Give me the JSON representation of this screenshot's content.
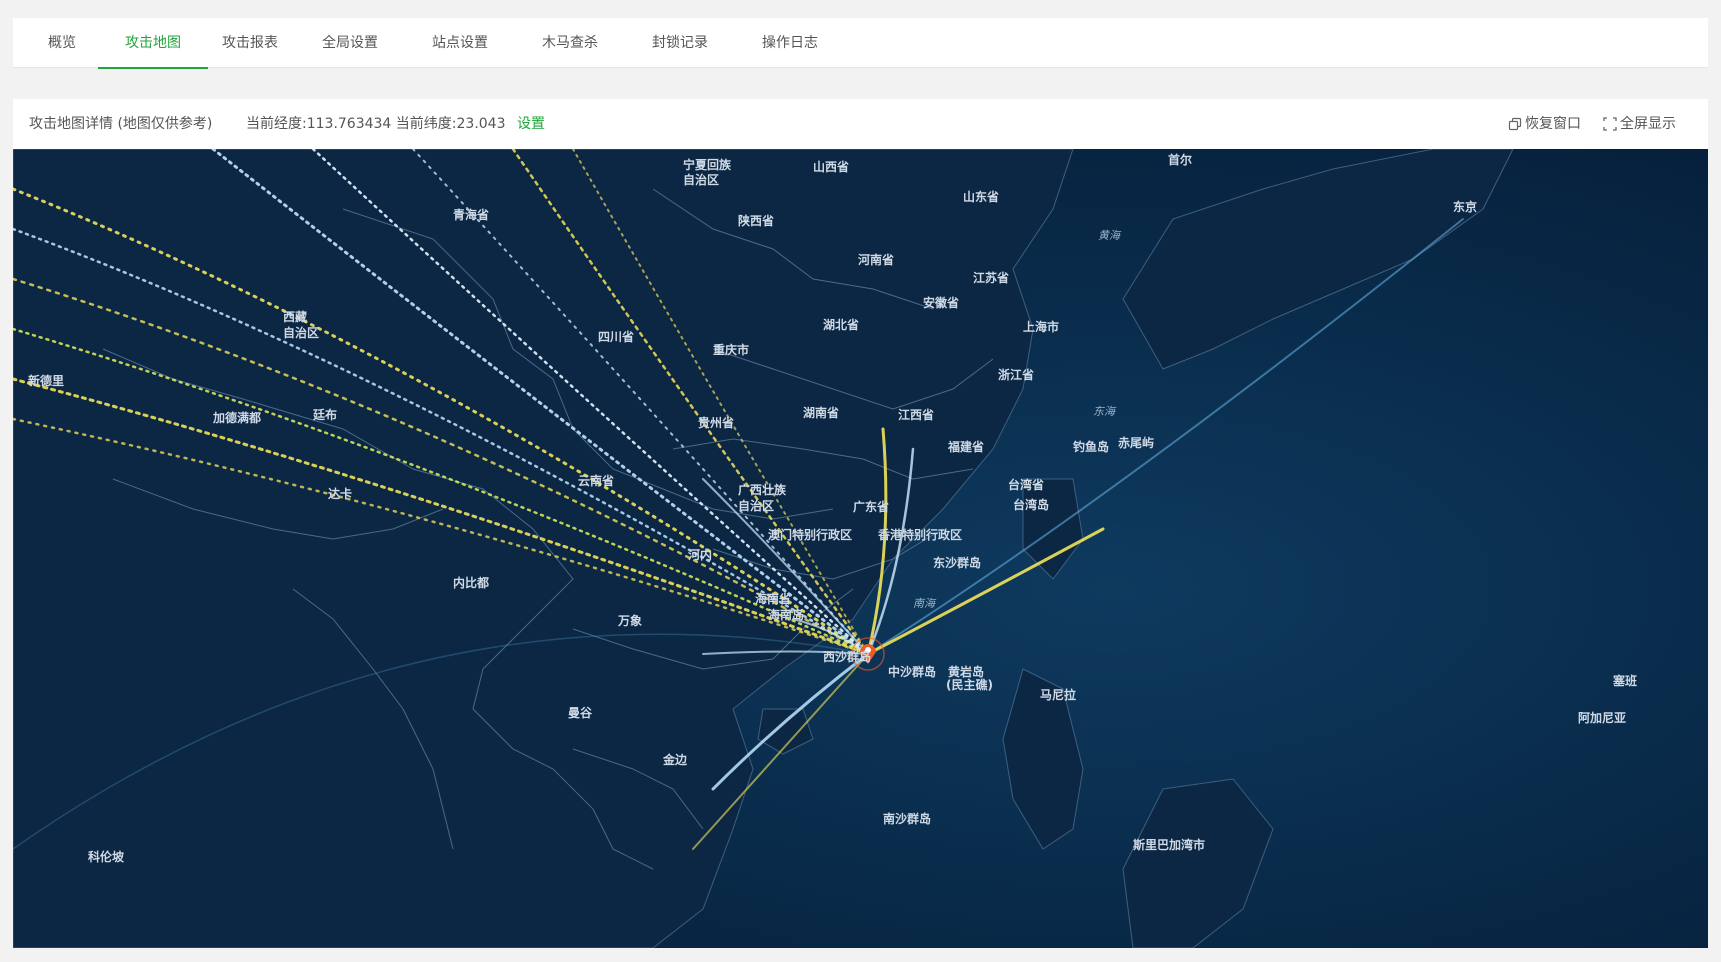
{
  "tabs": [
    {
      "label": "概览",
      "active": false
    },
    {
      "label": "攻击地图",
      "active": true
    },
    {
      "label": "攻击报表",
      "active": false
    },
    {
      "label": "全局设置",
      "active": false
    },
    {
      "label": "站点设置",
      "active": false
    },
    {
      "label": "木马查杀",
      "active": false
    },
    {
      "label": "封锁记录",
      "active": false
    },
    {
      "label": "操作日志",
      "active": false
    }
  ],
  "panel": {
    "title": "攻击地图详情 (地图仅供参考)",
    "coords": "当前经度:113.763434 当前纬度:23.043",
    "set_label": "设置",
    "restore_label": "恢复窗口",
    "fullscreen_label": "全屏显示",
    "restore_icon": "restore-window-icon",
    "fullscreen_icon": "fullscreen-icon"
  },
  "map": {
    "target_marker": "location-pin-icon",
    "colors": {
      "ocean": "#06223e",
      "land": "#0a2540",
      "border": "#3f5f7f",
      "arc_yellow": "#f2e35a",
      "arc_blue": "#bfe4ff",
      "marker": "#ee5a24"
    },
    "place_labels": [
      "宁夏回族",
      "自治区",
      "山西省",
      "首尔",
      "山东省",
      "东京",
      "青海省",
      "陕西省",
      "黄海",
      "河南省",
      "江苏省",
      "安徽省",
      "西藏",
      "自治区",
      "四川省",
      "湖北省",
      "上海市",
      "重庆市",
      "新德里",
      "浙江省",
      "加德满都",
      "廷布",
      "湖南省",
      "江西省",
      "东海",
      "贵州省",
      "钓鱼岛",
      "赤尾屿",
      "福建省",
      "云南省",
      "台湾省",
      "广西壮族",
      "自治区",
      "台湾岛",
      "达卡",
      "广东省",
      "香港特别行政区",
      "澳门特别行政区",
      "河内",
      "东沙群岛",
      "海南省",
      "内比都",
      "海南岛",
      "南海",
      "万象",
      "西沙群岛",
      "中沙群岛",
      "黄岩岛",
      "(民主礁)",
      "马尼拉",
      "塞班",
      "曼谷",
      "阿加尼亚",
      "金边",
      "南沙群岛",
      "斯里巴加湾市",
      "科伦坡"
    ]
  }
}
